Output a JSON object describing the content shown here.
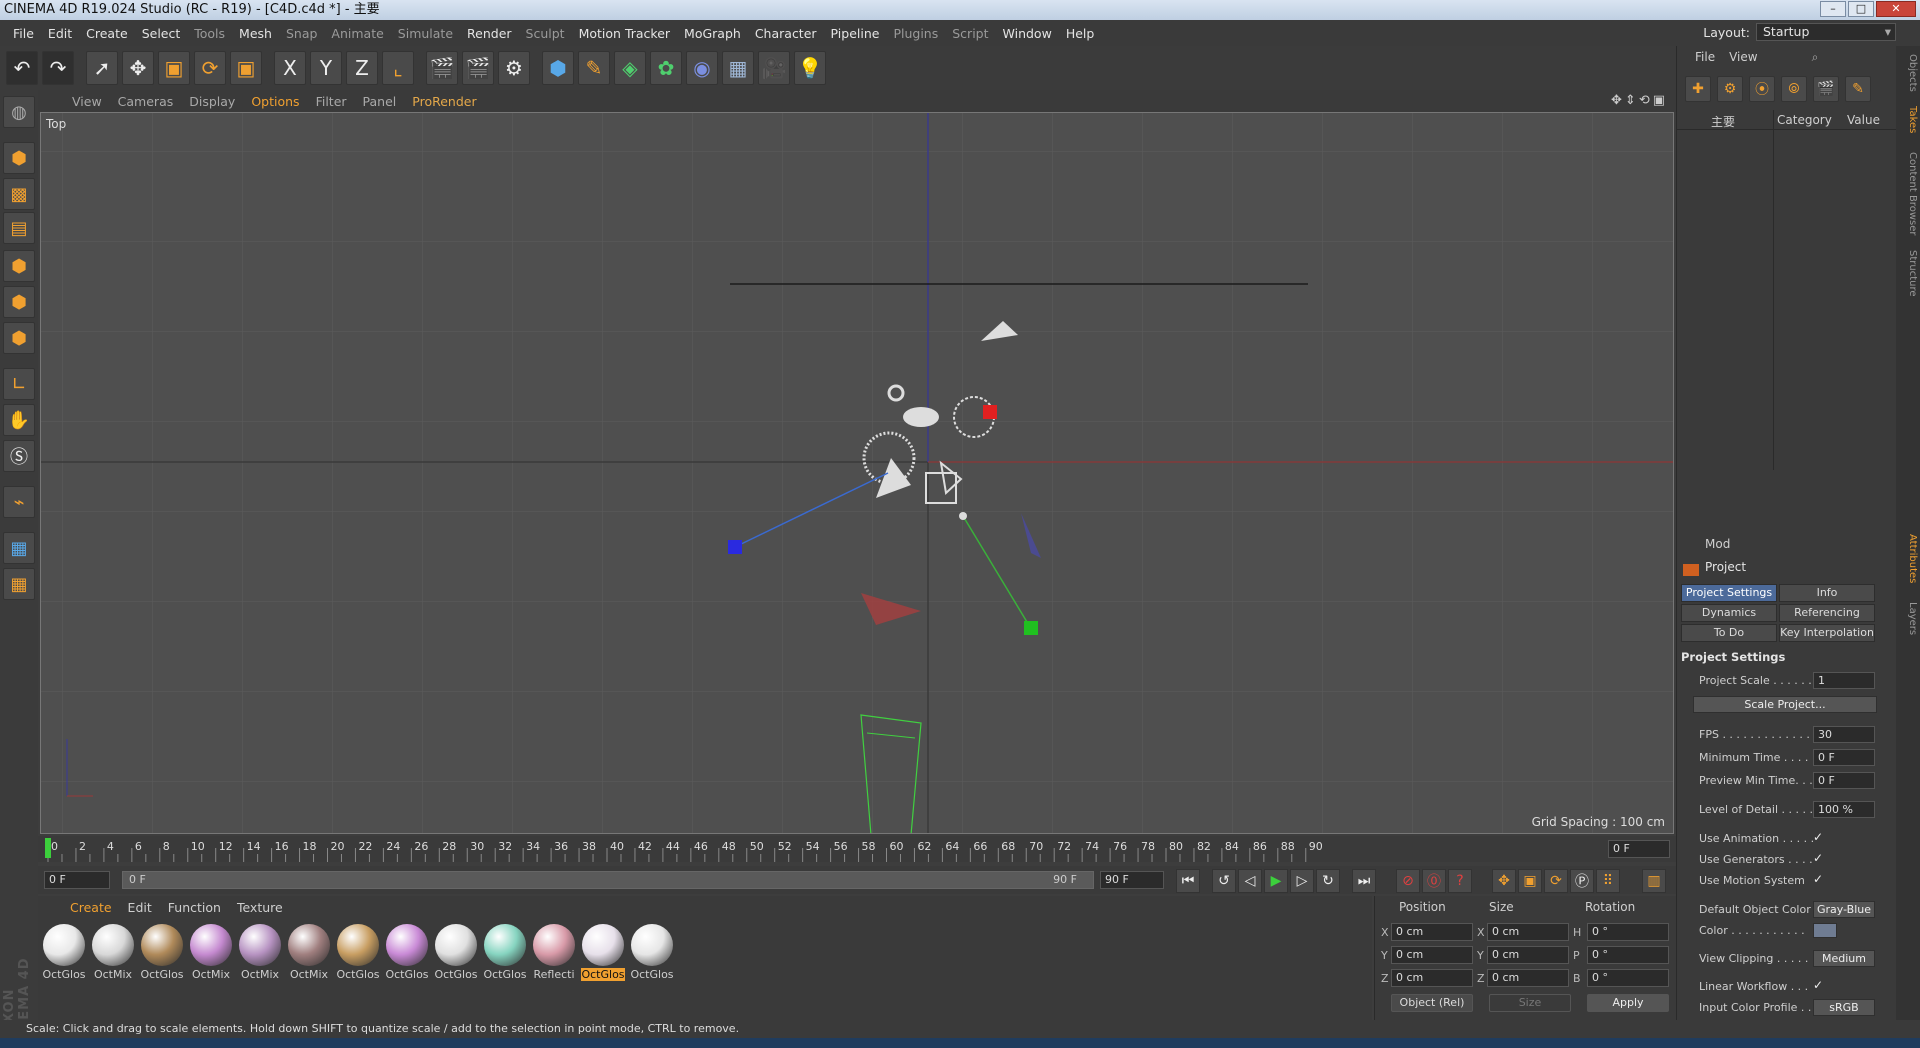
{
  "window": {
    "title": "CINEMA 4D R19.024 Studio (RC - R19) - [C4D.c4d *] - 主要"
  },
  "menu": [
    "File",
    "Edit",
    "Create",
    "Select",
    "Tools",
    "Mesh",
    "Snap",
    "Animate",
    "Simulate",
    "Render",
    "Sculpt",
    "Motion Tracker",
    "MoGraph",
    "Character",
    "Pipeline",
    "Plugins",
    "Script",
    "Window",
    "Help"
  ],
  "layout": {
    "label": "Layout:",
    "value": "Startup"
  },
  "toolbar": {
    "icons": [
      "undo-icon",
      "redo-icon",
      "live-select-icon",
      "move-icon",
      "scale-icon",
      "rotate-icon",
      "last-tool-icon",
      "x-axis-icon",
      "y-axis-icon",
      "z-axis-icon",
      "coordinate-system-icon",
      "render-view-icon",
      "render-picture-viewer-icon",
      "edit-render-settings-icon",
      "cube-icon",
      "pen-icon",
      "subdivision-icon",
      "cloner-icon",
      "deformer-icon",
      "floor-icon",
      "camera-icon",
      "light-icon"
    ],
    "axis_labels": [
      "X",
      "Y",
      "Z"
    ]
  },
  "viewport_menu": [
    "View",
    "Cameras",
    "Display",
    "Options",
    "Filter",
    "Panel",
    "ProRender"
  ],
  "viewport": {
    "name": "Top",
    "grid_spacing": "Grid Spacing : 100 cm"
  },
  "timeline": {
    "ticks": [
      "0",
      "2",
      "4",
      "6",
      "8",
      "10",
      "12",
      "14",
      "16",
      "18",
      "20",
      "22",
      "24",
      "26",
      "28",
      "30",
      "32",
      "34",
      "36",
      "38",
      "40",
      "42",
      "44",
      "46",
      "48",
      "50",
      "52",
      "54",
      "56",
      "58",
      "60",
      "62",
      "64",
      "66",
      "68",
      "70",
      "72",
      "74",
      "76",
      "78",
      "80",
      "82",
      "84",
      "86",
      "88",
      "90"
    ],
    "current_frame": "0 F",
    "start": "0 F",
    "slider_start": "0 F",
    "slider_end": "90 F",
    "end": "90 F"
  },
  "material_menu": [
    "Create",
    "Edit",
    "Function",
    "Texture"
  ],
  "materials": [
    {
      "name": "OctGlos",
      "color": "#e8e8e8"
    },
    {
      "name": "OctMix",
      "color": "#d8d8d8"
    },
    {
      "name": "OctGlos",
      "color": "#b08a5a"
    },
    {
      "name": "OctMix",
      "color": "#c58ad0"
    },
    {
      "name": "OctMix",
      "color": "#b793c2"
    },
    {
      "name": "OctMix",
      "color": "#a07f7f"
    },
    {
      "name": "OctGlos",
      "color": "#c89e62"
    },
    {
      "name": "OctGlos",
      "color": "#c98ad6"
    },
    {
      "name": "OctGlos",
      "color": "#e0e0e0"
    },
    {
      "name": "OctGlos",
      "color": "#86d4c0"
    },
    {
      "name": "Reflecti",
      "color": "#d89aa8"
    },
    {
      "name": "OctGlos",
      "color": "#e7e0ea"
    },
    {
      "name": "OctGlos",
      "color": "#e6e6e6"
    }
  ],
  "coords": {
    "headers": [
      "Position",
      "Size",
      "Rotation"
    ],
    "axes": [
      "X",
      "Y",
      "Z"
    ],
    "rot_axes": [
      "H",
      "P",
      "B"
    ],
    "pos": [
      "0 cm",
      "0 cm",
      "0 cm"
    ],
    "size": [
      "0 cm",
      "0 cm",
      "0 cm"
    ],
    "rot": [
      "0 °",
      "0 °",
      "0 °"
    ],
    "mode": "Object (Rel)",
    "size_mode": "Size",
    "apply": "Apply"
  },
  "status": "Scale: Click and drag to scale elements. Hold down SHIFT to quantize scale / add to the selection in point mode, CTRL to remove.",
  "objects_panel": {
    "menu": [
      "File",
      "View"
    ],
    "take_name": "主要",
    "columns": [
      "Category",
      "Value"
    ]
  },
  "right_tabs": [
    "Objects",
    "Takes",
    "Content Browser",
    "Structure",
    "Attributes",
    "Layers"
  ],
  "attributes": {
    "mode": "Mod",
    "title": "Project",
    "tabs": [
      "Project Settings",
      "Info",
      "Dynamics",
      "Referencing",
      "To Do",
      "Key Interpolation"
    ],
    "section": "Project Settings",
    "project_scale": {
      "label": "Project Scale . . . . . .",
      "value": "1"
    },
    "scale_button": "Scale Project...",
    "fps": {
      "label": "FPS . . . . . . . . . . . . . .",
      "value": "30"
    },
    "min_time": {
      "label": "Minimum Time . . . . .",
      "value": "0 F"
    },
    "preview_min": {
      "label": "Preview Min Time. . .",
      "value": "0 F"
    },
    "lod": {
      "label": "Level of Detail . . . . .",
      "value": "100 %"
    },
    "use_animation": "Use Animation . . . . .",
    "use_generators": "Use Generators . . . .",
    "use_motion": "Use Motion System",
    "default_color": {
      "label": "Default Object Color",
      "value": "Gray-Blue"
    },
    "color": "Color . . . . . . . . . . .",
    "view_clipping": {
      "label": "View Clipping . . . . .",
      "value": "Medium"
    },
    "linear_workflow": "Linear Workflow . . .",
    "input_profile": {
      "label": "Input Color Profile . .",
      "value": "sRGB"
    },
    "check": "✓"
  },
  "brand": "MAXON CINEMA 4D"
}
